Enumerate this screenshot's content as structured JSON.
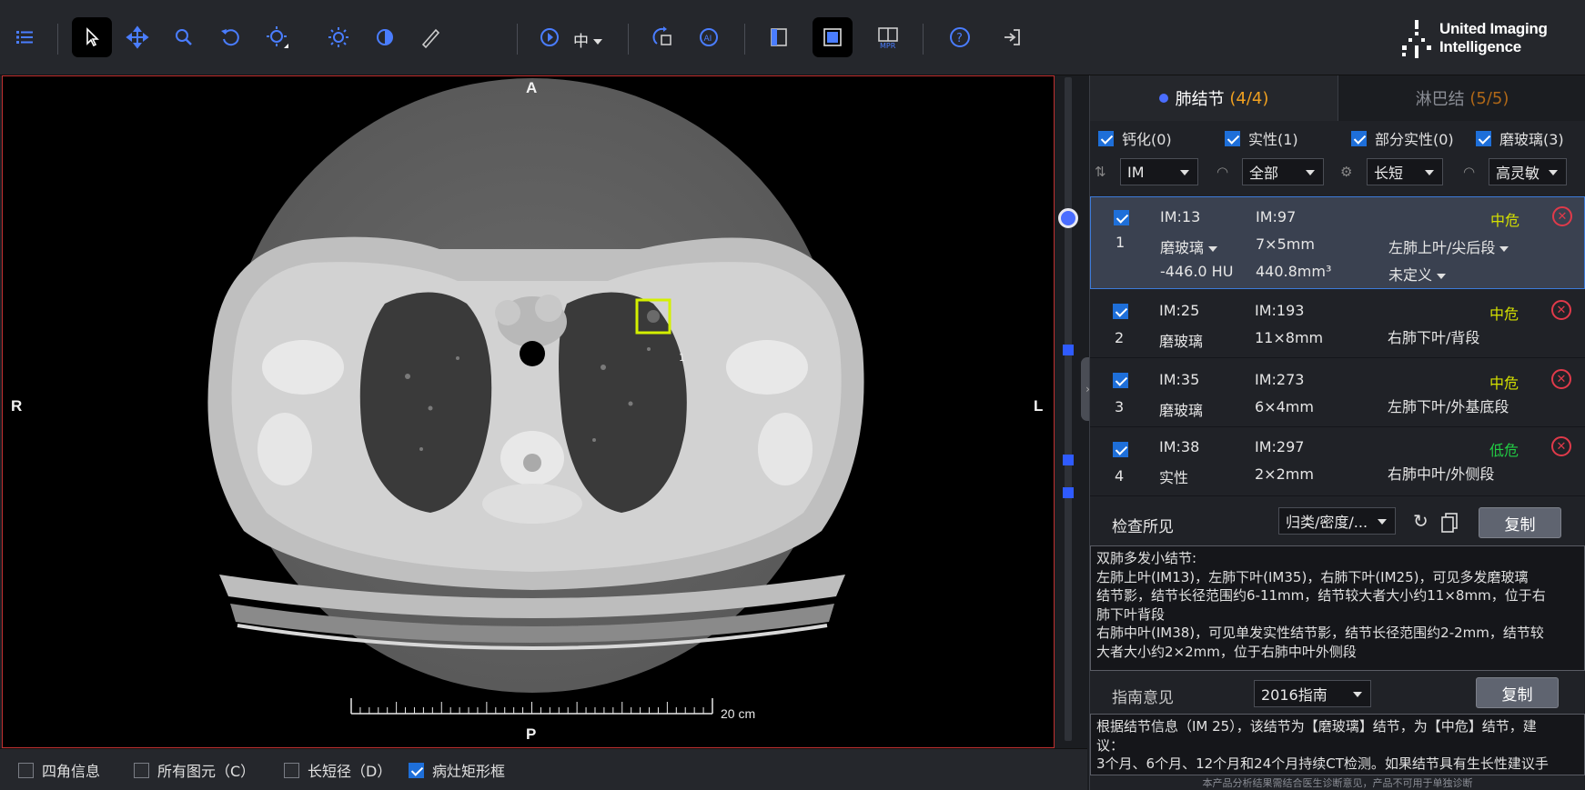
{
  "toolbar": {
    "zoom_label": "中",
    "icons": [
      "list-icon",
      "pointer-icon",
      "pan-icon",
      "zoom-icon",
      "rotate-icon",
      "window-level-icon",
      "brightness-icon",
      "invert-icon",
      "measure-icon",
      "play-icon",
      "sync-icon",
      "ai-icon",
      "layout-icon",
      "single-view-icon",
      "mpr-icon",
      "help-icon",
      "exit-icon"
    ]
  },
  "logo": {
    "line1": "United Imaging",
    "line2": "Intelligence"
  },
  "viewer": {
    "orient_top": "A",
    "orient_bottom": "P",
    "orient_left": "R",
    "orient_right": "L",
    "scale_label": "20 cm",
    "marker_label": "1"
  },
  "bottombar": {
    "items": [
      {
        "label": "四角信息",
        "checked": false
      },
      {
        "label": "所有图元（C）",
        "checked": false
      },
      {
        "label": "长短径（D）",
        "checked": false
      },
      {
        "label": "病灶矩形框",
        "checked": true
      }
    ]
  },
  "panel": {
    "tab_nodule": {
      "label": "肺结节",
      "count": "(4/4)"
    },
    "tab_lymph": {
      "label": "淋巴结",
      "count": "(5/5)"
    },
    "filters": [
      {
        "label": "钙化(0)",
        "checked": true
      },
      {
        "label": "实性(1)",
        "checked": true
      },
      {
        "label": "部分实性(0)",
        "checked": true
      },
      {
        "label": "磨玻璃(3)",
        "checked": true
      }
    ],
    "dropdowns": [
      {
        "icon": "sort-icon",
        "value": "IM"
      },
      {
        "icon": "gauge-icon",
        "value": "全部"
      },
      {
        "icon": "settings-icon",
        "value": "长短"
      },
      {
        "icon": "sensitivity-icon",
        "value": "高灵敏"
      }
    ],
    "nodules": [
      {
        "index": "1",
        "im": "IM:13",
        "im2": "IM:97",
        "type": "磨玻璃",
        "size": "7×5mm",
        "location": "左肺上叶/尖后段",
        "hu": "-446.0 HU",
        "volume": "440.8mm³",
        "status": "未定义",
        "risk": "中危",
        "risk_level": "mid",
        "checked": true,
        "selected": true
      },
      {
        "index": "2",
        "im": "IM:25",
        "im2": "IM:193",
        "type": "磨玻璃",
        "size": "11×8mm",
        "location": "右肺下叶/背段",
        "risk": "中危",
        "risk_level": "mid",
        "checked": true
      },
      {
        "index": "3",
        "im": "IM:35",
        "im2": "IM:273",
        "type": "磨玻璃",
        "size": "6×4mm",
        "location": "左肺下叶/外基底段",
        "risk": "中危",
        "risk_level": "mid",
        "checked": true
      },
      {
        "index": "4",
        "im": "IM:38",
        "im2": "IM:297",
        "type": "实性",
        "size": "2×2mm",
        "location": "右肺中叶/外侧段",
        "risk": "低危",
        "risk_level": "low",
        "checked": true
      }
    ],
    "findings": {
      "label": "检查所见",
      "dropdown": "归类/密度/...",
      "copy": "复制",
      "lines": [
        "双肺多发小结节:",
        "左肺上叶(IM13)，左肺下叶(IM35)，右肺下叶(IM25)，可见多发磨玻璃",
        "结节影，结节长径范围约6-11mm，结节较大者大小约11×8mm，位于右",
        "肺下叶背段",
        "右肺中叶(IM38)，可见单发实性结节影，结节长径范围约2-2mm，结节较",
        "大者大小约2×2mm，位于右肺中叶外侧段"
      ]
    },
    "guideline": {
      "label": "指南意见",
      "dropdown": "2016指南",
      "copy": "复制",
      "lines": [
        "根据结节信息（IM 25），该结节为【磨玻璃】结节，为【中危】结节，建",
        "议：",
        "3个月、6个月、12个月和24个月持续CT检测。如果结节具有生长性建议手"
      ]
    },
    "disclaimer": "本产品分析结果需结合医生诊断意见，产品不可用于单独诊断"
  },
  "colors": {
    "accent": "#4a6dff",
    "risk_mid": "#d4e000",
    "risk_low": "#22cc44",
    "delete": "#e03a4a",
    "count": "#f0a020"
  }
}
